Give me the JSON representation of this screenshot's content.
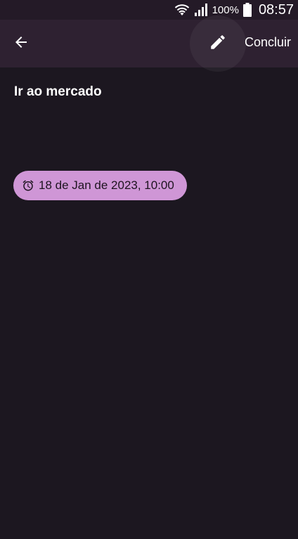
{
  "status_bar": {
    "battery_percent": "100%",
    "time": "08:57",
    "icons": [
      "wifi-icon",
      "signal-icon",
      "battery-icon"
    ]
  },
  "app_bar": {
    "back_icon": "arrow-left-icon",
    "edit_icon": "pencil-icon",
    "done_label": "Concluir"
  },
  "note": {
    "title": "Ir ao mercado",
    "reminder": {
      "icon": "alarm-icon",
      "label": "18 de Jan de 2023, 10:00"
    }
  },
  "colors": {
    "background": "#1c1720",
    "app_bar": "#2e2131",
    "chip": "#cf96d6"
  }
}
